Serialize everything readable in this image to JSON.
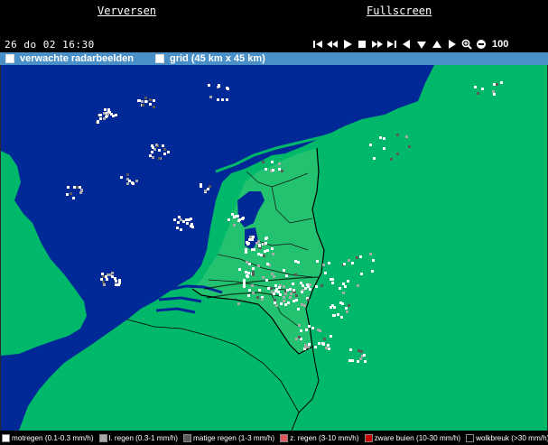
{
  "links": {
    "refresh": "Verversen",
    "fullscreen": "Fullscreen"
  },
  "controls": {
    "timestamp": "26 do 02 16:30",
    "zoom_level": "100",
    "buttons": [
      "skip-first-icon",
      "step-back-icon",
      "play-icon",
      "stop-icon",
      "step-forward-icon",
      "skip-last-icon",
      "pan-left-icon",
      "pan-down-icon",
      "pan-up-icon",
      "pan-right-icon",
      "zoom-in-icon",
      "zoom-out-icon"
    ]
  },
  "options": {
    "forecast_label": "verwachte radarbeelden",
    "grid_label": "grid (45 km x 45 km)",
    "forecast_checked": false,
    "grid_checked": false
  },
  "map": {
    "sea_color": "#002896",
    "land_color": "#00b86a",
    "nl_land_color": "#22c270",
    "border_color": "#000000"
  },
  "legend": [
    {
      "label": "motregen (0.1-0.3 mm/h)",
      "color": "#ffffff"
    },
    {
      "label": "l. regen (0.3-1 mm/h)",
      "color": "#a9a9a9"
    },
    {
      "label": "matige regen (1-3 mm/h)",
      "color": "#5a5a5a"
    },
    {
      "label": "z. regen (3-10 mm/h)",
      "color": "#e05858"
    },
    {
      "label": "zware buien (10-30 mm/h)",
      "color": "#c80000"
    },
    {
      "label": "wolkbreuk (>30 mm/h)",
      "color": "#000000"
    }
  ]
}
